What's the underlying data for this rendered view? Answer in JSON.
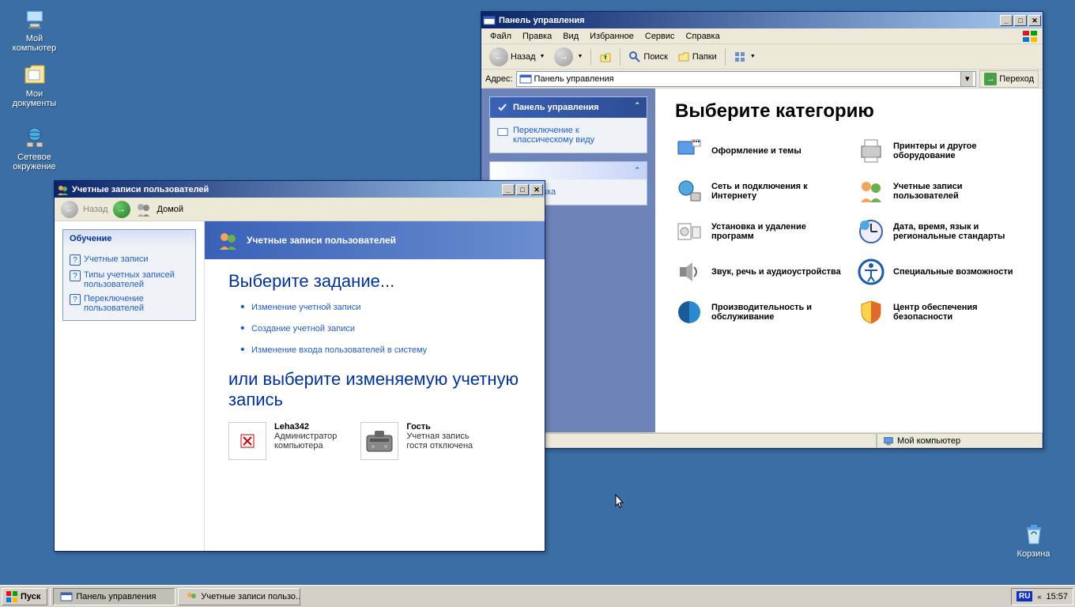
{
  "desktop": {
    "my_computer": "Мой компьютер",
    "my_documents": "Мои документы",
    "network": "Сетевое окружение",
    "recycle": "Корзина"
  },
  "cp_window": {
    "title": "Панель управления",
    "menu": {
      "file": "Файл",
      "edit": "Правка",
      "view": "Вид",
      "favorites": "Избранное",
      "tools": "Сервис",
      "help": "Справка"
    },
    "toolbar": {
      "back": "Назад",
      "search": "Поиск",
      "folders": "Папки"
    },
    "address_label": "Адрес:",
    "address_value": "Панель управления",
    "go": "Переход",
    "side": {
      "cp_header": "Панель управления",
      "switch_classic": "Переключение к классическому виду",
      "seealso_help": "и поддержка"
    },
    "heading": "Выберите категорию",
    "categories": [
      {
        "name": "Оформление и темы",
        "icon": "appearance"
      },
      {
        "name": "Принтеры и другое оборудование",
        "icon": "printers"
      },
      {
        "name": "Сеть и подключения к Интернету",
        "icon": "network"
      },
      {
        "name": "Учетные записи пользователей",
        "icon": "users"
      },
      {
        "name": "Установка и удаление программ",
        "icon": "addremove"
      },
      {
        "name": "Дата, время, язык и региональные стандарты",
        "icon": "datetime"
      },
      {
        "name": "Звук, речь и аудиоустройства",
        "icon": "sound"
      },
      {
        "name": "Специальные возможности",
        "icon": "accessibility"
      },
      {
        "name": "Производительность и обслуживание",
        "icon": "performance"
      },
      {
        "name": "Центр обеспечения безопасности",
        "icon": "security"
      }
    ],
    "status": "Мой компьютер"
  },
  "ua_window": {
    "title": "Учетные записи пользователей",
    "nav": {
      "back": "Назад",
      "home": "Домой"
    },
    "learn_header": "Обучение",
    "learn_links": [
      "Учетные записи",
      "Типы учетных записей пользователей",
      "Переключение пользователей"
    ],
    "banner": "Учетные записи пользователей",
    "task_heading": "Выберите задание...",
    "tasks": [
      "Изменение учетной записи",
      "Создание учетной записи",
      "Изменение входа пользователей в систему"
    ],
    "or_heading": "или выберите изменяемую учетную запись",
    "accounts": [
      {
        "name": "Leha342",
        "desc1": "Администратор",
        "desc2": "компьютера"
      },
      {
        "name": "Гость",
        "desc1": "Учетная запись",
        "desc2": "гостя отключена"
      }
    ]
  },
  "taskbar": {
    "start": "Пуск",
    "tasks": [
      "Панель управления",
      "Учетные записи пользо..."
    ],
    "lang": "RU",
    "time": "15:57"
  }
}
